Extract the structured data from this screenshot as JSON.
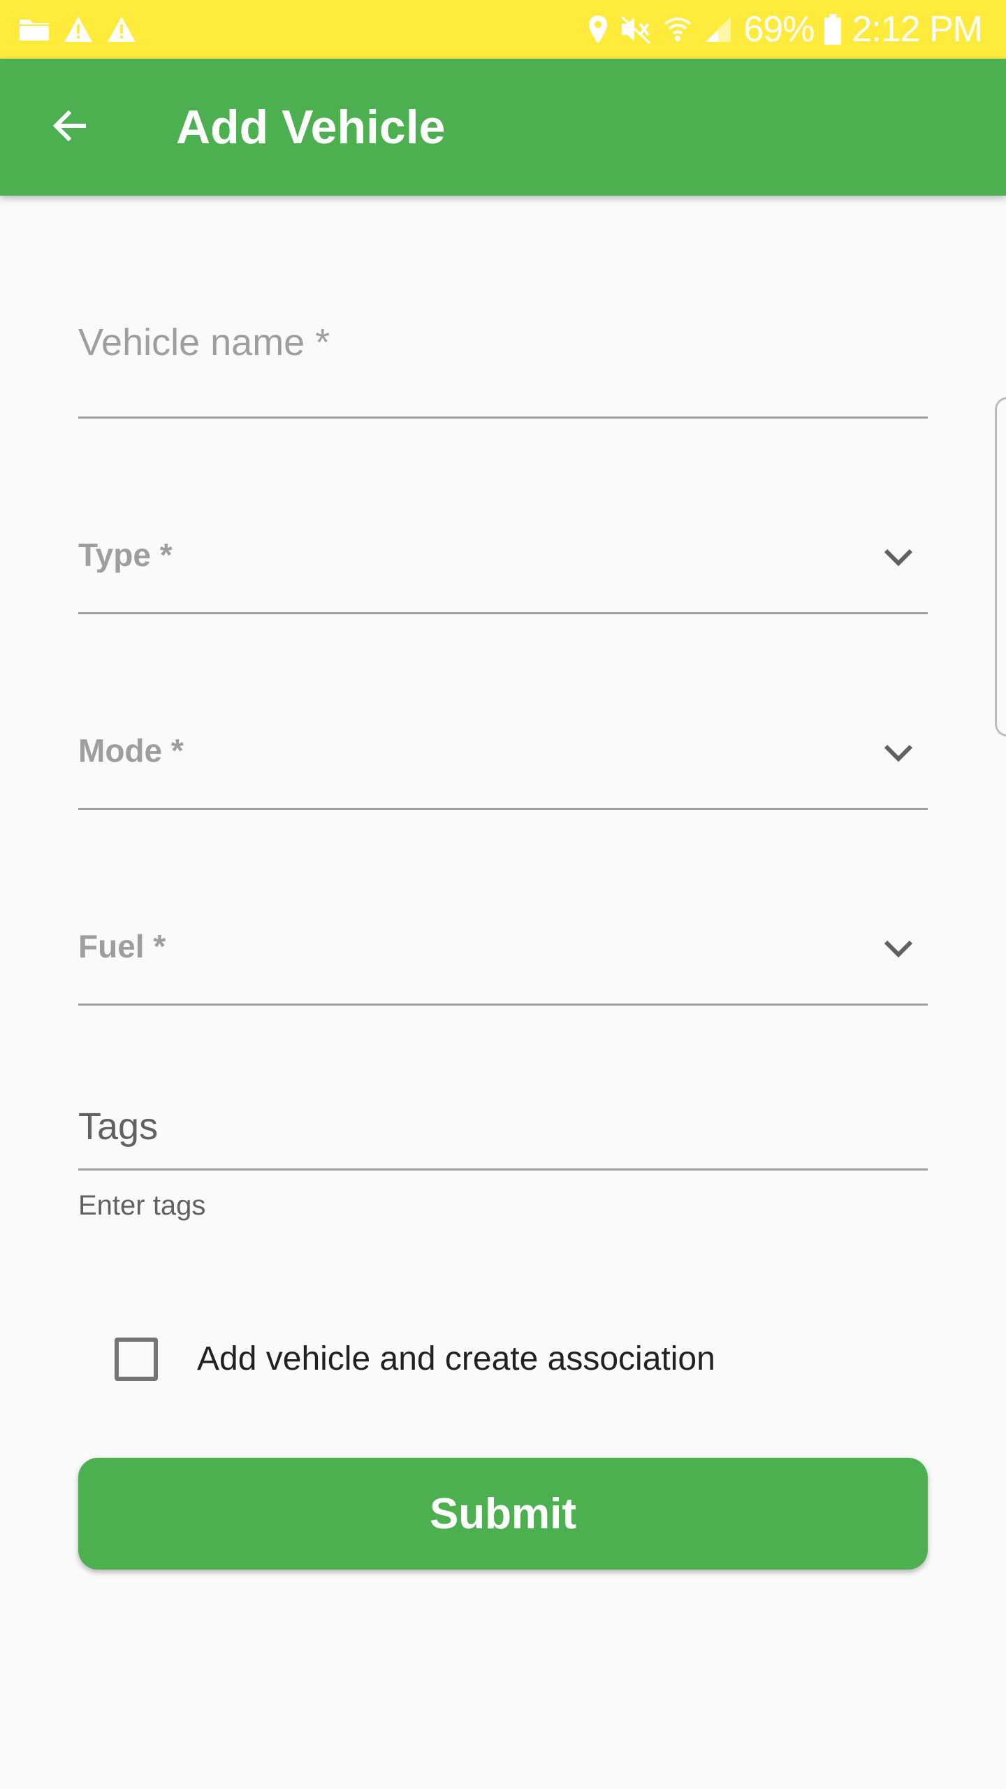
{
  "status_bar": {
    "battery": "69%",
    "time": "2:12 PM",
    "left_icons": [
      "folder-icon",
      "warning-icon",
      "warning-icon"
    ],
    "right_icons": [
      "location-icon",
      "mute-icon",
      "wifi-icon",
      "signal-icon",
      "battery-icon"
    ],
    "background_color": "#ffeb3b"
  },
  "app_bar": {
    "title": "Add Vehicle",
    "back_icon": "arrow-back-icon",
    "background_color": "#4caf50"
  },
  "form": {
    "vehicle_name": {
      "label": "Vehicle name *",
      "value": ""
    },
    "type": {
      "label": "Type *",
      "value": ""
    },
    "mode": {
      "label": "Mode *",
      "value": ""
    },
    "fuel": {
      "label": "Fuel *",
      "value": ""
    },
    "tags": {
      "label": "Tags",
      "helper": "Enter tags",
      "value": ""
    },
    "association": {
      "label": "Add vehicle and create association",
      "checked": false
    },
    "submit_label": "Submit"
  }
}
